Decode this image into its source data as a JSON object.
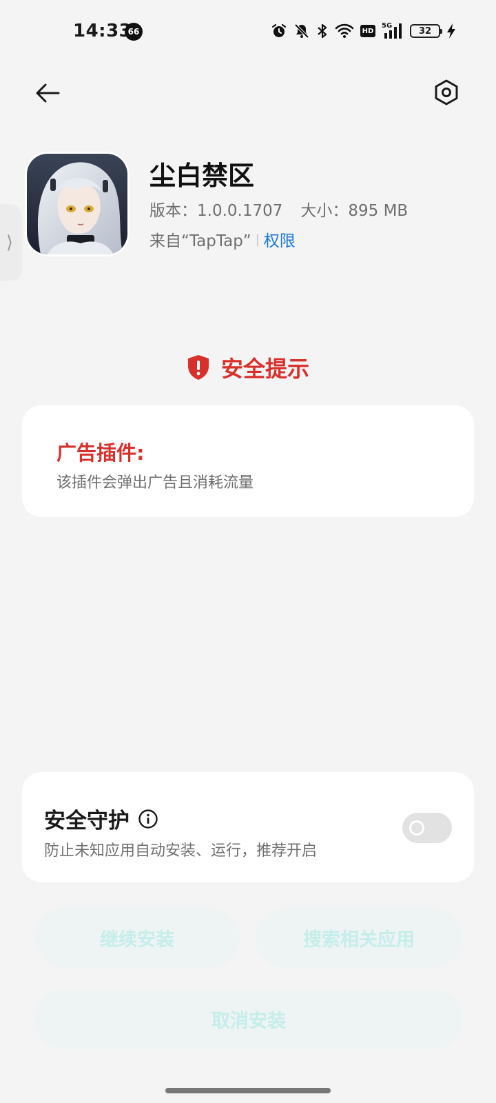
{
  "status_bar": {
    "time": "14:33",
    "notification_count": "66",
    "network_label": "5G",
    "hd_label": "HD",
    "battery_level": "32",
    "icons": [
      "alarm-icon",
      "mute-icon",
      "bluetooth-icon",
      "wifi-icon",
      "hd-icon",
      "signal-icon",
      "battery-icon",
      "charging-icon"
    ]
  },
  "toolbar": {
    "back_icon": "arrow-left-icon",
    "settings_icon": "gear-icon"
  },
  "side_handle": {
    "glyph": "⟩"
  },
  "app": {
    "name": "尘白禁区",
    "version": "版本：1.0.0.1707",
    "size": "大小：895 MB",
    "source": "来自“TapTap”",
    "separator": "|",
    "permissions_link": "权限"
  },
  "warning": {
    "title": "安全提示",
    "icon": "shield-alert-icon",
    "color": "#d9302b"
  },
  "ad_plugin": {
    "title": "广告插件:",
    "description": "该插件会弹出广告且消耗流量"
  },
  "security_guard": {
    "title": "安全守护",
    "info_icon": "info-icon",
    "description": "防止未知应用自动安装、运行，推荐开启",
    "enabled": false
  },
  "actions": {
    "continue_install": "继续安装",
    "search_related": "搜索相关应用",
    "cancel_install": "取消安装"
  },
  "colors": {
    "accent_red": "#d9302b",
    "link_blue": "#1a78d6",
    "button_text_disabled": "#c4eeea",
    "background": "#f4f4f4"
  }
}
